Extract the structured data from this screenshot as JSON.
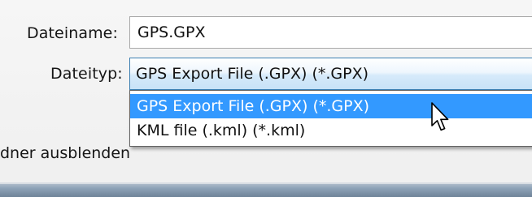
{
  "dialog": {
    "filename_label": "Dateiname:",
    "filename_value": "GPS.GPX",
    "filetype_label": "Dateityp:",
    "filetype_selected": "GPS Export File (.GPX) (*.GPX)",
    "filetype_options": [
      {
        "label": "GPS Export File (.GPX) (*.GPX)",
        "highlighted": true
      },
      {
        "label": "KML file (.kml) (*.kml)",
        "highlighted": false
      }
    ],
    "hide_folders_label": "dner ausblenden"
  },
  "colors": {
    "highlight": "#3399ff",
    "select_border": "#3c7fb1"
  },
  "icons": {
    "cursor": "mouse-pointer-icon"
  }
}
